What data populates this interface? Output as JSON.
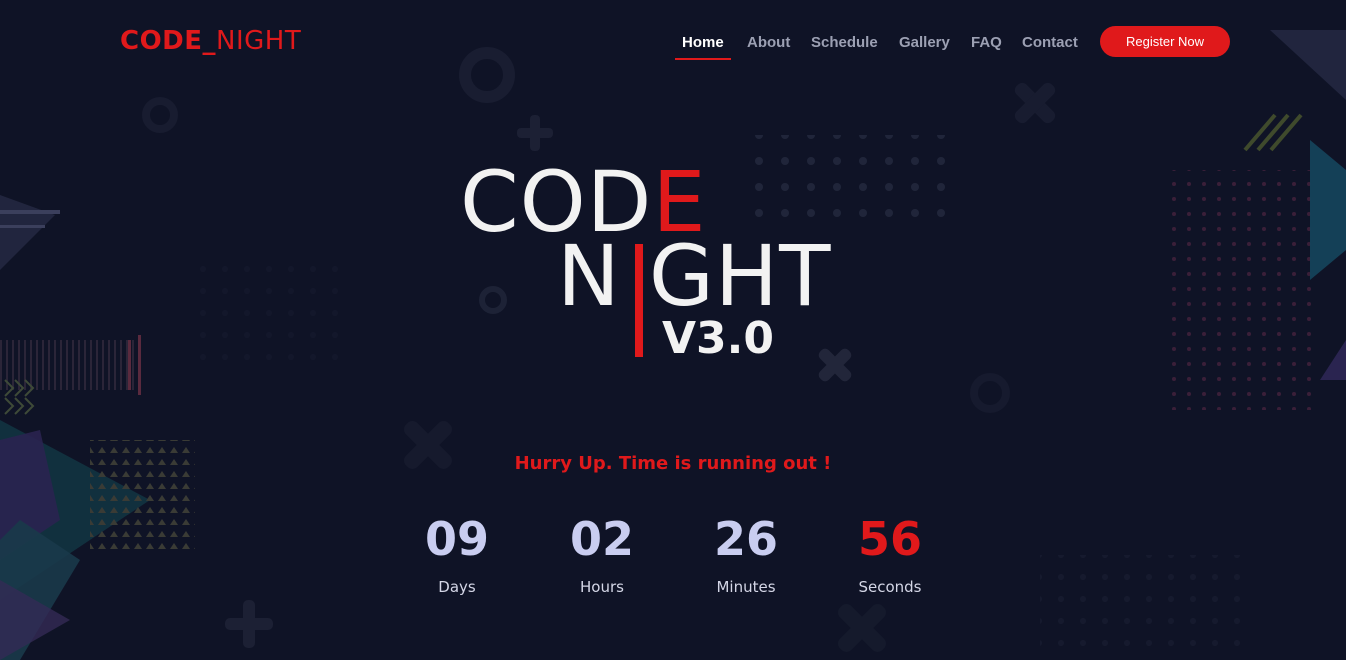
{
  "brand": {
    "logo_part1": "CODE_",
    "logo_part2": "NIGHT"
  },
  "nav": {
    "items": [
      {
        "label": "Home",
        "active": true
      },
      {
        "label": "About",
        "active": false
      },
      {
        "label": "Schedule",
        "active": false
      },
      {
        "label": "Gallery",
        "active": false
      },
      {
        "label": "FAQ",
        "active": false
      },
      {
        "label": "Contact",
        "active": false
      }
    ],
    "cta_label": "Register Now"
  },
  "hero": {
    "title_line1_a": "COD",
    "title_line1_b": "E",
    "title_line2_a": "N",
    "title_line2_b": "GHT",
    "version": "V3.0"
  },
  "countdown": {
    "message": "Hurry Up. Time is running out !",
    "units": [
      {
        "value": "09",
        "label": "Days"
      },
      {
        "value": "02",
        "label": "Hours"
      },
      {
        "value": "26",
        "label": "Minutes"
      },
      {
        "value": "56",
        "label": "Seconds"
      }
    ]
  },
  "colors": {
    "background": "#0f1326",
    "accent": "#e0191b",
    "countdown_number": "#c9cdf0",
    "nav_inactive": "#9ca0b3"
  }
}
